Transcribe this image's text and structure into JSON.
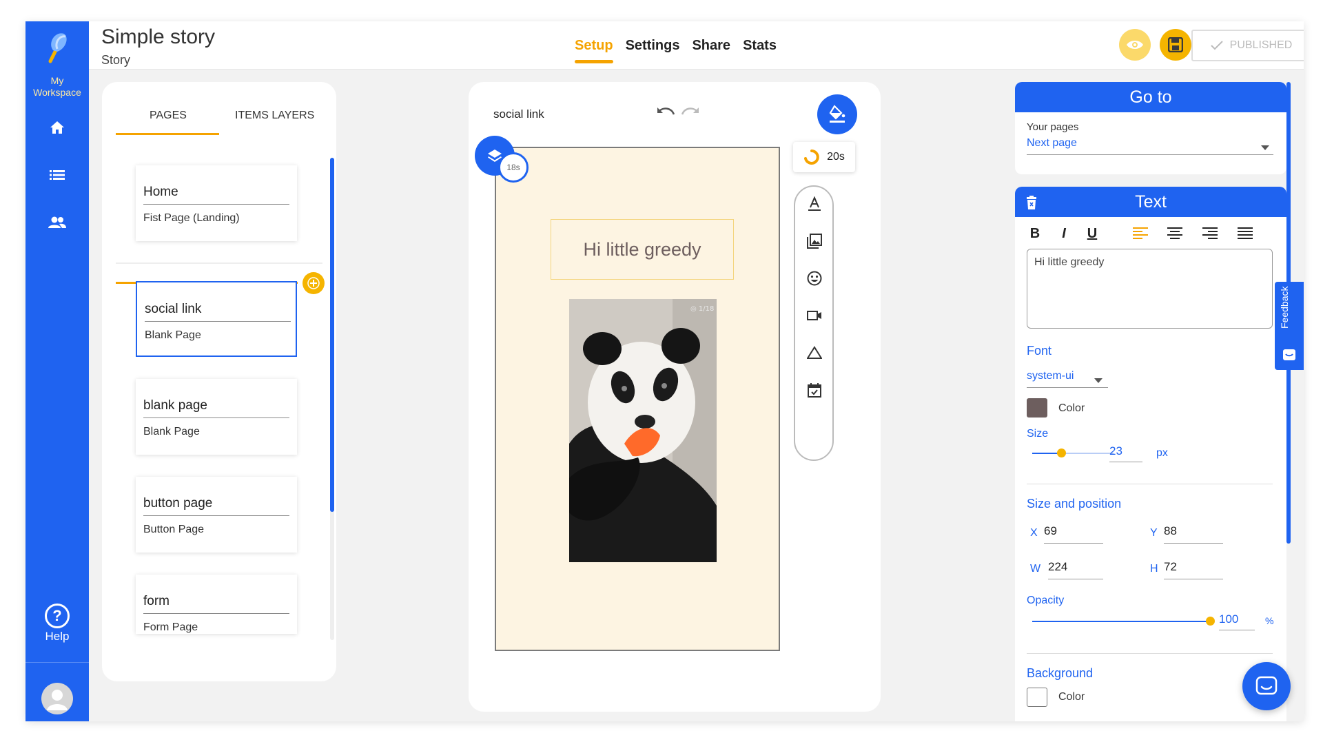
{
  "workspace": {
    "label": "My Workspace"
  },
  "nav": {
    "help_label": "Help"
  },
  "header": {
    "title": "Simple story",
    "subtitle": "Story",
    "tabs": [
      "Setup",
      "Settings",
      "Share",
      "Stats"
    ],
    "active_tab": "Setup",
    "published_label": "PUBLISHED"
  },
  "pages_panel": {
    "tabs": [
      "PAGES",
      "ITEMS LAYERS"
    ],
    "pages": [
      {
        "name": "Home",
        "desc": "Fist Page (Landing)"
      },
      {
        "name": "social link",
        "desc": "Blank Page"
      },
      {
        "name": "blank page",
        "desc": "Blank Page"
      },
      {
        "name": "button page",
        "desc": "Button Page"
      },
      {
        "name": "form",
        "desc": "Form Page"
      }
    ]
  },
  "canvas": {
    "page_name": "social link",
    "text_element": "Hi little greedy",
    "layer_timer": "18s",
    "duration": "20s"
  },
  "goto_panel": {
    "title": "Go to",
    "field_label": "Your pages",
    "selected": "Next page"
  },
  "text_panel": {
    "title": "Text",
    "content": "Hi little greedy",
    "font_label": "Font",
    "font_value": "system-ui",
    "color_label": "Color",
    "text_color": "#6d5e5e",
    "size_label": "Size",
    "size_value": "23",
    "size_unit": "px",
    "size_pos_label": "Size and position",
    "x_label": "X",
    "x_value": "69",
    "y_label": "Y",
    "y_value": "88",
    "w_label": "W",
    "w_value": "224",
    "h_label": "H",
    "h_value": "72",
    "opacity_label": "Opacity",
    "opacity_value": "100",
    "opacity_unit": "%",
    "background_label": "Background",
    "bg_color_label": "Color"
  },
  "feedback_label": "Feedback",
  "colors": {
    "brand": "#1f63f0",
    "accent": "#f5a300"
  }
}
